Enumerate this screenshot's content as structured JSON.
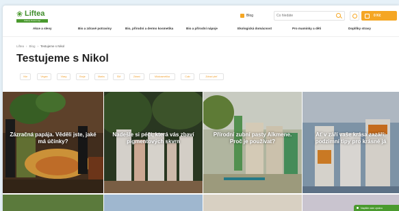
{
  "header": {
    "logo_name": "Liftea",
    "logo_tagline": "Zdravý životní styl",
    "blog_label": "Blog",
    "search_placeholder": "Co hledáte",
    "cart_label": "0 Kč"
  },
  "nav": {
    "items": [
      "Akce a slevy",
      "Bio a zdravé potraviny",
      "Bio, přírodní a dermo kosmetika",
      "Bio a přírodní nápoje",
      "Ekologická domácnost",
      "Pro maminky a děti",
      "Doplňky stravy"
    ]
  },
  "breadcrumb": {
    "items": [
      "Liftea",
      "Blog",
      "Testujeme s Nikol"
    ]
  },
  "page_title": "Testujeme s Nikol",
  "tags": [
    "Vše",
    "Vegan",
    "Vlasy",
    "Bruje",
    "Marks",
    "SM",
    "Zdraví",
    "Mlokosmetika",
    "Cukr",
    "Zdraví pleť"
  ],
  "cards": [
    {
      "title": "Zázračná papája. Věděli jste, jaké má účinky?"
    },
    {
      "title": "Nadešle si péči, která vás zbaví pigmentových skvrn"
    },
    {
      "title": "Přírodní zubní pasty Alkmene. Proč je používat?"
    },
    {
      "title": "Ať v září vaše krása zazáří: podzimní tipy pro krásné já"
    }
  ],
  "chat": {
    "label": "Napište nám zprávu"
  },
  "colors": {
    "accent": "#f5a623",
    "brand_green": "#4a9a2e"
  }
}
